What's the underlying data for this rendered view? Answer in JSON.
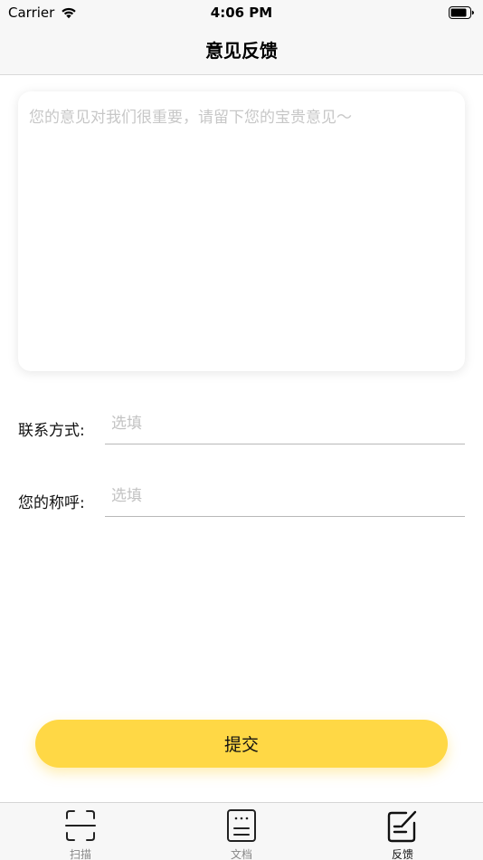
{
  "status_bar": {
    "carrier": "Carrier",
    "time": "4:06 PM"
  },
  "nav": {
    "title": "意见反馈"
  },
  "feedback": {
    "placeholder": "您的意见对我们很重要，请留下您的宝贵意见～",
    "value": ""
  },
  "form": {
    "contact": {
      "label": "联系方式:",
      "placeholder": "选填",
      "value": ""
    },
    "name": {
      "label": "您的称呼:",
      "placeholder": "选填",
      "value": ""
    }
  },
  "submit": {
    "label": "提交"
  },
  "tabs": [
    {
      "label": "扫描",
      "icon": "scan-icon",
      "active": false
    },
    {
      "label": "文档",
      "icon": "document-icon",
      "active": false
    },
    {
      "label": "反馈",
      "icon": "feedback-edit-icon",
      "active": true
    }
  ],
  "colors": {
    "accent": "#ffd845",
    "bar_background": "#f7f7f7",
    "placeholder": "#c7c7c7",
    "inactive_tab": "#888888",
    "active_tab": "#111111"
  }
}
